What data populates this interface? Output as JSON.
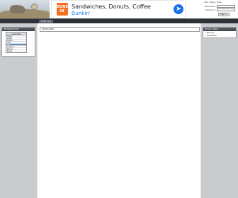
{
  "ad": {
    "logo_text": "DUNK\nIN'",
    "title": "Sandwiches, Donuts, Coffee",
    "subtitle": "Dunkin'",
    "arrow_icon": "directions-arrow-icon"
  },
  "login": {
    "links": "Info | Sign | Help",
    "username_label": "Username",
    "password_label": "Password",
    "button_label": "Sign in"
  },
  "nav": {
    "items": [
      "TEXT (%)"
    ]
  },
  "sidebar_left": {
    "box_title": "INFORMATION",
    "calendar": {
      "header": "Calendar",
      "rows": [
        "Today",
        "Week",
        "Month",
        "Year",
        "All",
        "Custom",
        "Range",
        "Find 1",
        "Find 2"
      ],
      "selected_index": 4
    }
  },
  "main": {
    "input_value": "HEADLINES"
  },
  "sidebar_right": {
    "box_title": "QUICK LINKS",
    "items": [
      "Recent",
      "Feedback"
    ]
  },
  "colors": {
    "nav_bg": "#2f3138",
    "sidebar_bg": "#c9cbce",
    "ad_accent": "#1a73e8",
    "ad_logo": "#f36f21"
  }
}
